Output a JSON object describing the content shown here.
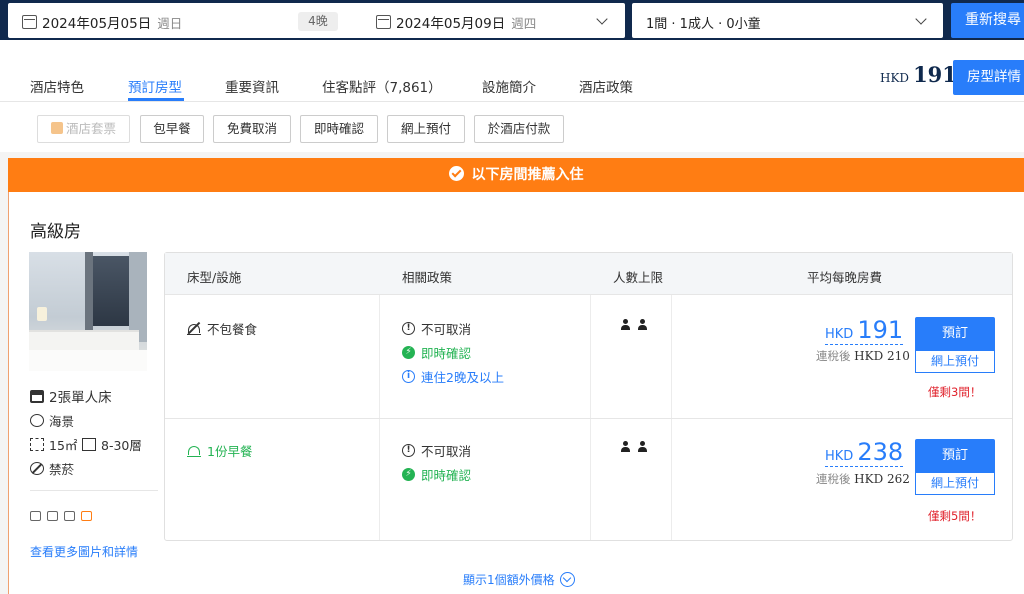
{
  "search": {
    "checkin_date": "2024年05月05日",
    "checkin_weekday": "週日",
    "nights": "4晚",
    "checkout_date": "2024年05月09日",
    "checkout_weekday": "週四",
    "guests": "1間 · 1成人 · 0小童",
    "research_label": "重新搜尋"
  },
  "tabs": [
    {
      "label": "酒店特色"
    },
    {
      "label": "預訂房型",
      "active": true
    },
    {
      "label": "重要資訊"
    },
    {
      "label": "住客點評（7,861）"
    },
    {
      "label": "設施簡介"
    },
    {
      "label": "酒店政策"
    }
  ],
  "header_price": {
    "currency": "HKD",
    "amount": "191",
    "button": "房型詳情"
  },
  "filters": [
    {
      "label": "酒店套票",
      "disabled": true
    },
    {
      "label": "包早餐"
    },
    {
      "label": "免費取消"
    },
    {
      "label": "即時確認"
    },
    {
      "label": "網上預付"
    },
    {
      "label": "於酒店付款"
    }
  ],
  "banner": "以下房間推薦入住",
  "room": {
    "title": "高級房",
    "features": {
      "bed": "2張單人床",
      "view": "海景",
      "area": "15㎡",
      "floor": "8-30層",
      "smoking": "禁菸"
    },
    "amenity_icons": [
      "tv-icon",
      "coffee-icon",
      "bath-icon",
      "toiletries-icon"
    ],
    "more_link": "查看更多圖片和詳情"
  },
  "table": {
    "headers": [
      "床型/設施",
      "相關政策",
      "人數上限",
      "平均每晚房費"
    ],
    "rows": [
      {
        "meal": "不包餐食",
        "policies": [
          "不可取消",
          "即時確認",
          "連住2晚及以上"
        ],
        "max_guests": 2,
        "currency": "HKD",
        "price": "191",
        "tax_label": "連稅後",
        "tax_price": "HKD 210",
        "book_label": "預訂",
        "pay_label": "網上預付",
        "rooms_left": "僅剩3間！"
      },
      {
        "meal": "1份早餐",
        "policies": [
          "不可取消",
          "即時確認"
        ],
        "max_guests": 2,
        "currency": "HKD",
        "price": "238",
        "tax_label": "連稅後",
        "tax_price": "HKD 262",
        "book_label": "預訂",
        "pay_label": "網上預付",
        "rooms_left": "僅剩5間！"
      }
    ]
  },
  "show_more": "顯示1個額外價格",
  "colors": {
    "navy": "#10294d",
    "primary": "#287dfa",
    "orange": "#ff7d13",
    "green": "#24b353",
    "red": "#e0222c"
  }
}
